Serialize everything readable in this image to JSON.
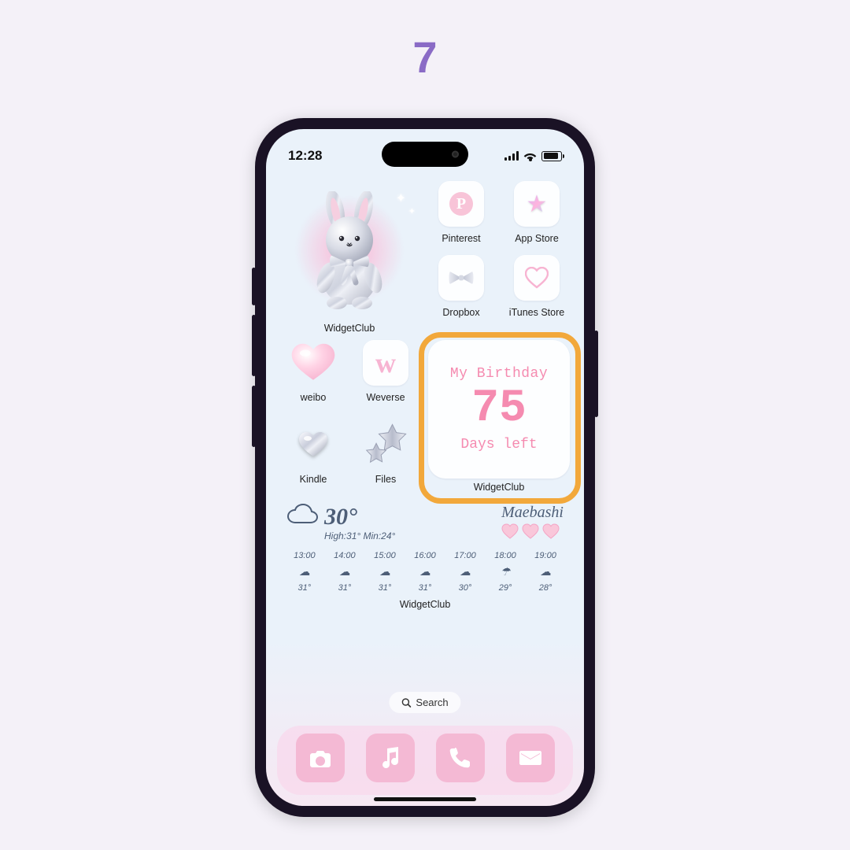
{
  "step_number": "7",
  "status": {
    "time": "12:28"
  },
  "widgets": {
    "bunny_widget_label": "WidgetClub",
    "countdown": {
      "title": "My Birthday",
      "number": "75",
      "sub": "Days left",
      "label": "WidgetClub"
    },
    "weather": {
      "temp": "30°",
      "high_low": "High:31° Min:24°",
      "city": "Maebashi",
      "label": "WidgetClub",
      "forecast": [
        {
          "time": "13:00",
          "icon": "cloud",
          "temp": "31°"
        },
        {
          "time": "14:00",
          "icon": "cloud",
          "temp": "31°"
        },
        {
          "time": "15:00",
          "icon": "cloud",
          "temp": "31°"
        },
        {
          "time": "16:00",
          "icon": "cloud",
          "temp": "31°"
        },
        {
          "time": "17:00",
          "icon": "cloud",
          "temp": "30°"
        },
        {
          "time": "18:00",
          "icon": "umbrella",
          "temp": "29°"
        },
        {
          "time": "19:00",
          "icon": "cloud",
          "temp": "28°"
        }
      ]
    }
  },
  "apps": {
    "pinterest": {
      "label": "Pinterest"
    },
    "appstore": {
      "label": "App Store"
    },
    "dropbox": {
      "label": "Dropbox"
    },
    "itunes": {
      "label": "iTunes Store"
    },
    "weibo": {
      "label": "weibo"
    },
    "weverse": {
      "label": "Weverse"
    },
    "kindle": {
      "label": "Kindle"
    },
    "files": {
      "label": "Files"
    }
  },
  "search_label": "Search",
  "dock": {
    "camera": "camera",
    "music": "music",
    "phone": "phone",
    "mail": "mail"
  },
  "colors": {
    "highlight": "#f2a83b",
    "pink": "#f7b4d2",
    "countdown_text": "#f58bb0",
    "weather_text": "#4d5e77",
    "phone_frame": "#1a1225",
    "page_bg": "#f4f1f8"
  }
}
